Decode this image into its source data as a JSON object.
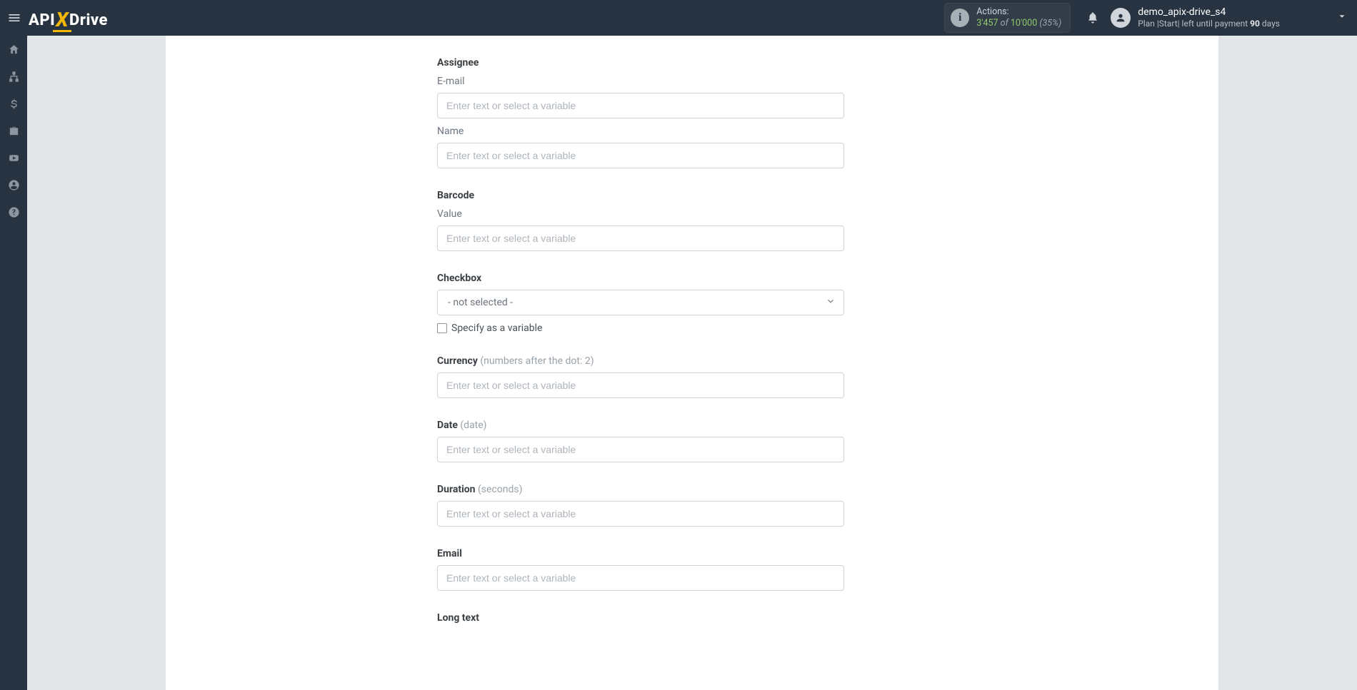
{
  "header": {
    "logo": {
      "left": "API",
      "mid": "X",
      "right": "Drive"
    },
    "actions": {
      "label": "Actions:",
      "current": "3'457",
      "of": "of",
      "total": "10'000",
      "percent": "(35%)"
    },
    "user": {
      "name": "demo_apix-drive_s4",
      "plan_prefix": "Plan |Start| left until payment ",
      "days_num": "90",
      "days_suffix": " days"
    }
  },
  "sidebar": {
    "items": [
      {
        "name": "home"
      },
      {
        "name": "connections"
      },
      {
        "name": "billing"
      },
      {
        "name": "work"
      },
      {
        "name": "video"
      },
      {
        "name": "account"
      },
      {
        "name": "help"
      }
    ]
  },
  "form": {
    "placeholder": "Enter text or select a variable",
    "sections": {
      "assignee": {
        "title": "Assignee",
        "email_label": "E-mail",
        "name_label": "Name"
      },
      "barcode": {
        "title": "Barcode",
        "value_label": "Value"
      },
      "checkbox": {
        "title": "Checkbox",
        "selected": "- not selected -",
        "specify_label": "Specify as a variable"
      },
      "currency": {
        "title": "Currency",
        "hint": "(numbers after the dot: 2)"
      },
      "date": {
        "title": "Date",
        "hint": "(date)"
      },
      "duration": {
        "title": "Duration",
        "hint": "(seconds)"
      },
      "email": {
        "title": "Email"
      },
      "longtext": {
        "title": "Long text"
      }
    }
  }
}
